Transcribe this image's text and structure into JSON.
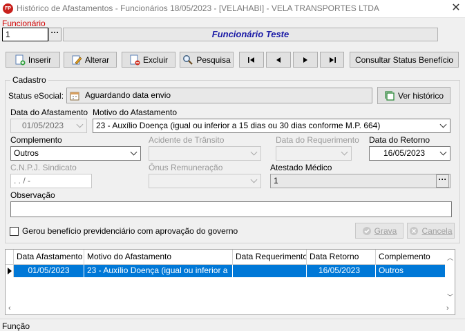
{
  "window": {
    "title": "Histórico de Afastamentos - Funcionários  18/05/2023 - [VELAHABI] - VELA TRANSPORTES LTDA",
    "app_icon": "FP"
  },
  "employee": {
    "label": "Funcionário",
    "code": "1",
    "name": "Funcionário Teste"
  },
  "toolbar": {
    "insert": "Inserir",
    "edit": "Alterar",
    "delete": "Excluir",
    "search": "Pesquisa",
    "consult": "Consultar Status Benefício"
  },
  "cadastro": {
    "title": "Cadastro",
    "status_label": "Status eSocial:",
    "status_value": "Aguardando data envio",
    "history_button": "Ver histórico",
    "afastamento_date_label": "Data do Afastamento",
    "afastamento_date": "01/05/2023",
    "motivo_label": "Motivo do Afastamento",
    "motivo_value": "23  -  Auxílio Doença (igual ou inferior a 15 dias ou 30 dias conforme M.P. 664)",
    "complemento_label": "Complemento",
    "complemento_value": "Outros",
    "acidente_label": "Acidente de Trânsito",
    "requerimento_label": "Data do Requerimento",
    "retorno_label": "Data do Retorno",
    "retorno_value": "16/05/2023",
    "cnpj_label": "C.N.P.J. Sindicato",
    "cnpj_value": " .  .  /   -",
    "onus_label": "Ônus Remuneração",
    "atestado_label": "Atestado Médico",
    "atestado_value": "1",
    "observacao_label": "Observação",
    "observacao_value": "",
    "gerou_label": "Gerou benefício previdenciário com aprovação do governo",
    "save_button": "Grava",
    "cancel_button": "Cancela"
  },
  "grid": {
    "columns": [
      "Data Afastamento",
      "Motivo do Afastamento",
      "Data Requerimento",
      "Data Retorno",
      "Complemento"
    ],
    "rows": [
      [
        "01/05/2023",
        "23  -  Auxílio Doença (igual ou inferior a",
        "",
        "16/05/2023",
        "Outros"
      ]
    ]
  },
  "statusbar": {
    "text": "Função"
  },
  "colors": {
    "selection": "#0078d7",
    "required_label": "#d00000",
    "title_name": "#1a1aa6"
  }
}
